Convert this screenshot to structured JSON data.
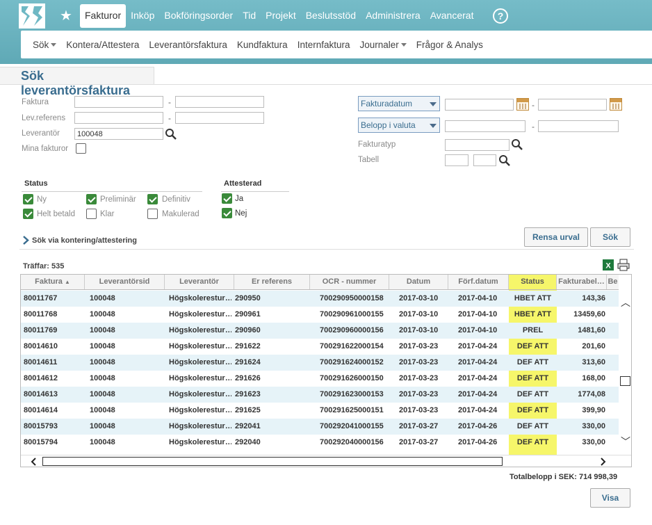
{
  "nav": {
    "items": [
      "Fakturor",
      "Inköp",
      "Bokföringsorder",
      "Tid",
      "Projekt",
      "Beslutsstöd",
      "Administrera",
      "Avancerat"
    ],
    "active": "Fakturor",
    "help": "?"
  },
  "subnav": {
    "items": [
      "Sök",
      "Kontera/Attestera",
      "Leverantörsfaktura",
      "Kundfaktura",
      "Internfaktura",
      "Journaler",
      "Frågor & Analys"
    ]
  },
  "page": {
    "title": "Sök leverantörsfaktura"
  },
  "form": {
    "faktura_label": "Faktura",
    "levref_label": "Lev.referens",
    "leverantor_label": "Leverantör",
    "leverantor_value": "100048",
    "mina_label": "Mina fakturor",
    "date_dropdown": "Fakturadatum",
    "amount_dropdown": "Belopp i valuta",
    "fakturatyp_label": "Fakturatyp",
    "tabell_label": "Tabell",
    "dash": "-"
  },
  "status": {
    "heading": "Status",
    "options": [
      {
        "label": "Ny",
        "checked": true
      },
      {
        "label": "Preliminär",
        "checked": true
      },
      {
        "label": "Definitiv",
        "checked": true
      },
      {
        "label": "Helt betald",
        "checked": true
      },
      {
        "label": "Klar",
        "checked": false
      },
      {
        "label": "Makulerad",
        "checked": false
      }
    ]
  },
  "attesterad": {
    "heading": "Attesterad",
    "options": [
      {
        "label": "Ja",
        "checked": true
      },
      {
        "label": "Nej",
        "checked": true
      }
    ]
  },
  "link": {
    "sok_via": "Sök via kontering/attestering"
  },
  "buttons": {
    "rensa": "Rensa urval",
    "sok": "Sök",
    "visa": "Visa"
  },
  "results": {
    "hits": "Träffar: 535",
    "columns": [
      "Faktura",
      "Leverantörsid",
      "Leverantör",
      "Er referens",
      "OCR - nummer",
      "Datum",
      "Förf.datum",
      "Status",
      "Fakturabel…",
      "Be"
    ],
    "sort_indicator": "▲",
    "rows": [
      [
        "80011767",
        "100048",
        "Högskolerestur…",
        "290950",
        "700290950000158",
        "2017-03-10",
        "2017-04-10",
        "HBET ATT",
        "143,36"
      ],
      [
        "80011768",
        "100048",
        "Högskolerestur…",
        "290961",
        "700290961000155",
        "2017-03-10",
        "2017-04-10",
        "HBET ATT",
        "13459,60"
      ],
      [
        "80011769",
        "100048",
        "Högskolerestur…",
        "290960",
        "700290960000156",
        "2017-03-10",
        "2017-04-10",
        "PREL",
        "1481,60"
      ],
      [
        "80014610",
        "100048",
        "Högskolerestur…",
        "291622",
        "700291622000154",
        "2017-03-23",
        "2017-04-24",
        "DEF ATT",
        "201,60"
      ],
      [
        "80014611",
        "100048",
        "Högskolerestur…",
        "291624",
        "700291624000152",
        "2017-03-23",
        "2017-04-24",
        "DEF ATT",
        "313,60"
      ],
      [
        "80014612",
        "100048",
        "Högskolerestur…",
        "291626",
        "700291626000150",
        "2017-03-23",
        "2017-04-24",
        "DEF ATT",
        "168,00"
      ],
      [
        "80014613",
        "100048",
        "Högskolerestur…",
        "291623",
        "700291623000153",
        "2017-03-23",
        "2017-04-24",
        "DEF ATT",
        "1774,08"
      ],
      [
        "80014614",
        "100048",
        "Högskolerestur…",
        "291625",
        "700291625000151",
        "2017-03-23",
        "2017-04-24",
        "DEF ATT",
        "399,90"
      ],
      [
        "80015793",
        "100048",
        "Högskolerestur…",
        "292041",
        "700292041000155",
        "2017-03-27",
        "2017-04-26",
        "DEF ATT",
        "330,00"
      ],
      [
        "80015794",
        "100048",
        "Högskolerestur…",
        "292040",
        "700292040000156",
        "2017-03-27",
        "2017-04-26",
        "DEF ATT",
        "330,00"
      ]
    ],
    "total": "Totalbelopp i SEK: 714 998,39"
  },
  "colors": {
    "header": "#6fb8c4",
    "status_highlight": "#f6f66a",
    "title": "#3a6d8f",
    "check": "#3a8a3a"
  }
}
